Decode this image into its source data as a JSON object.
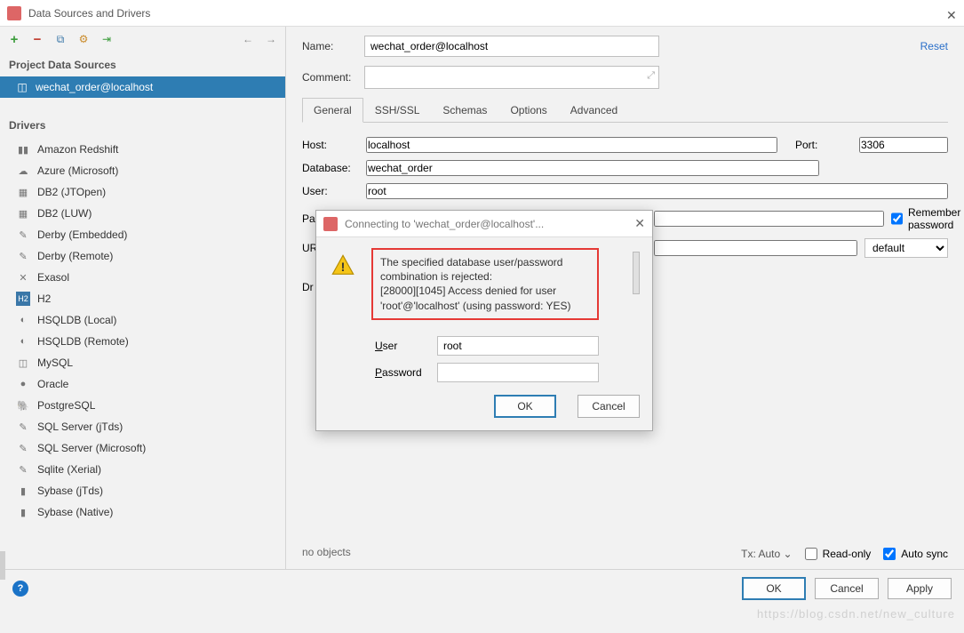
{
  "window": {
    "title": "Data Sources and Drivers"
  },
  "sidebar": {
    "project_title": "Project Data Sources",
    "datasource": {
      "name": "wechat_order@localhost"
    },
    "drivers_title": "Drivers",
    "drivers": [
      "Amazon Redshift",
      "Azure (Microsoft)",
      "DB2 (JTOpen)",
      "DB2 (LUW)",
      "Derby (Embedded)",
      "Derby (Remote)",
      "Exasol",
      "H2",
      "HSQLDB (Local)",
      "HSQLDB (Remote)",
      "MySQL",
      "Oracle",
      "PostgreSQL",
      "SQL Server (jTds)",
      "SQL Server (Microsoft)",
      "Sqlite (Xerial)",
      "Sybase (jTds)",
      "Sybase (Native)"
    ]
  },
  "form": {
    "name_label": "Name:",
    "name_value": "wechat_order@localhost",
    "reset": "Reset",
    "comment_label": "Comment:",
    "tabs": [
      "General",
      "SSH/SSL",
      "Schemas",
      "Options",
      "Advanced"
    ],
    "host_label": "Host:",
    "host_value": "localhost",
    "port_label": "Port:",
    "port_value": "3306",
    "db_label": "Database:",
    "db_value": "wechat_order",
    "user_label": "User:",
    "user_value": "root",
    "pw_label_trunc": "Pa",
    "remember_pw": "Remember password",
    "url_label_trunc": "UR",
    "driver_label_trunc": "Dr",
    "default_option": "default",
    "noobjects": "no objects",
    "tx": "Tx: Auto",
    "read_only": "Read-only",
    "auto_sync": "Auto sync"
  },
  "footer": {
    "ok": "OK",
    "cancel": "Cancel",
    "apply": "Apply"
  },
  "modal": {
    "title": "Connecting to 'wechat_order@localhost'...",
    "error_l1": "The specified database user/password combination is rejected:",
    "error_l2": "[28000][1045] Access denied for user 'root'@'localhost' (using password: YES)",
    "user_label": "User",
    "user_value": "root",
    "password_label": "Password",
    "ok": "OK",
    "cancel": "Cancel"
  }
}
